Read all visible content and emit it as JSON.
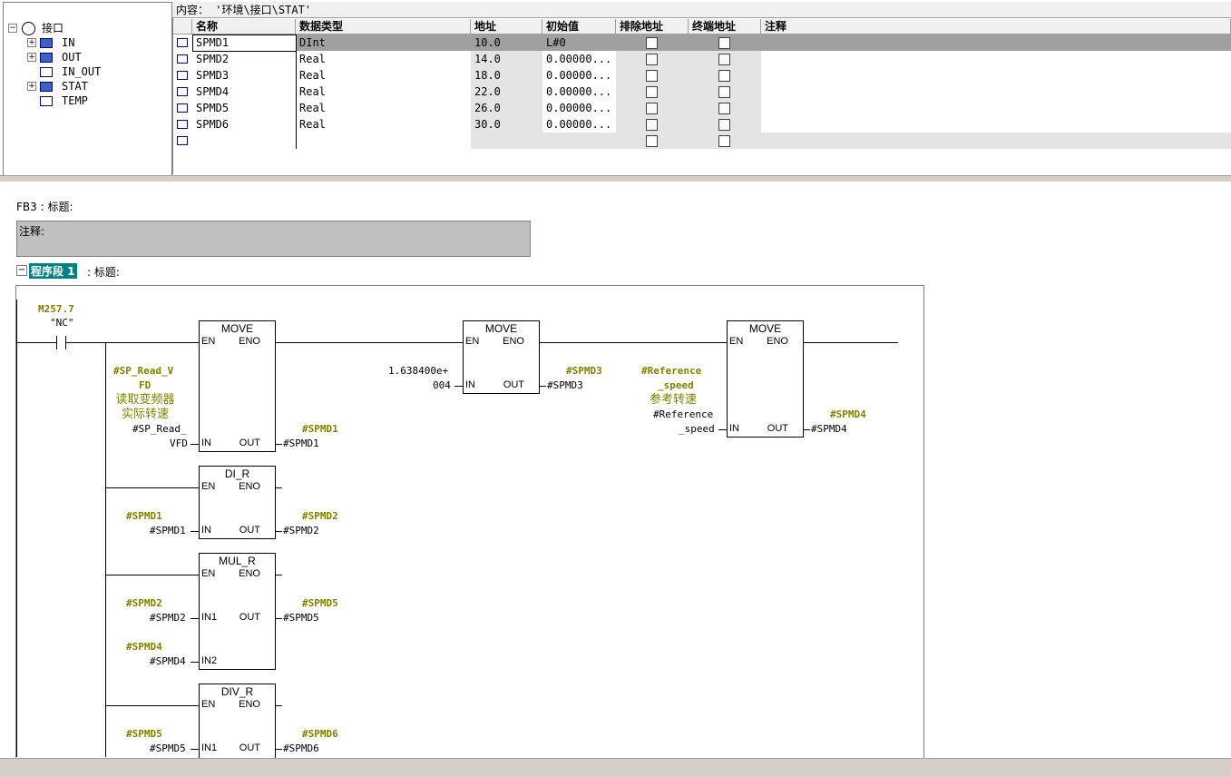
{
  "tree": {
    "root": "接口",
    "items": [
      {
        "label": "IN",
        "expand": "+"
      },
      {
        "label": "OUT",
        "expand": "+"
      },
      {
        "label": "IN_OUT",
        "expand": ""
      },
      {
        "label": "STAT",
        "expand": "+"
      },
      {
        "label": "TEMP",
        "expand": ""
      }
    ]
  },
  "content_path": "内容：  '环境\\接口\\STAT'",
  "table": {
    "headers": [
      "名称",
      "数据类型",
      "地址",
      "初始值",
      "排除地址",
      "终端地址",
      "注释"
    ],
    "rows": [
      {
        "name": "SPMD1",
        "type": "DInt",
        "address": "10.0",
        "init": "L#0"
      },
      {
        "name": "SPMD2",
        "type": "Real",
        "address": "14.0",
        "init": "0.00000..."
      },
      {
        "name": "SPMD3",
        "type": "Real",
        "address": "18.0",
        "init": "0.00000..."
      },
      {
        "name": "SPMD4",
        "type": "Real",
        "address": "22.0",
        "init": "0.00000..."
      },
      {
        "name": "SPMD5",
        "type": "Real",
        "address": "26.0",
        "init": "0.00000..."
      },
      {
        "name": "SPMD6",
        "type": "Real",
        "address": "30.0",
        "init": "0.00000..."
      }
    ]
  },
  "block": {
    "title": "FB3 : 标题:",
    "comment_label": "注释:",
    "network_label": "程序段 1",
    "network_title": ": 标题:"
  },
  "ladder": {
    "contact": {
      "address": "M257.7",
      "symbol": "\"NC\""
    },
    "move1": {
      "title": "MOVE",
      "en": "EN",
      "eno": "ENO",
      "in": "IN",
      "out": "OUT",
      "in_sym": "#SP_Read_V",
      "in_sym2": "FD",
      "in_cmt1": "读取变频器",
      "in_cmt2": "实际转速",
      "in_op1": "#SP_Read_",
      "in_op2": "VFD",
      "out_sym": "#SPMD1",
      "out_op": "#SPMD1"
    },
    "move2": {
      "title": "MOVE",
      "en": "EN",
      "eno": "ENO",
      "in": "IN",
      "out": "OUT",
      "in_op1": "1.638400e+",
      "in_op2": "004",
      "out_sym": "#SPMD3",
      "out_op": "#SPMD3"
    },
    "move3": {
      "title": "MOVE",
      "en": "EN",
      "eno": "ENO",
      "in": "IN",
      "out": "OUT",
      "in_sym1": "#Reference",
      "in_sym2": "_speed",
      "in_cmt": "参考转速",
      "in_op1": "#Reference",
      "in_op2": "_speed",
      "out_sym": "#SPMD4",
      "out_op": "#SPMD4"
    },
    "di_r": {
      "title": "DI_R",
      "en": "EN",
      "eno": "ENO",
      "in": "IN",
      "out": "OUT",
      "in_sym": "#SPMD1",
      "in_op": "#SPMD1",
      "out_sym": "#SPMD2",
      "out_op": "#SPMD2"
    },
    "mul_r": {
      "title": "MUL_R",
      "en": "EN",
      "eno": "ENO",
      "in1": "IN1",
      "in2": "IN2",
      "out": "OUT",
      "in1_sym": "#SPMD2",
      "in1_op": "#SPMD2",
      "in2_sym": "#SPMD4",
      "in2_op": "#SPMD4",
      "out_sym": "#SPMD5",
      "out_op": "#SPMD5"
    },
    "div_r": {
      "title": "DIV_R",
      "en": "EN",
      "eno": "ENO",
      "in1": "IN1",
      "out": "OUT",
      "in1_sym": "#SPMD5",
      "in1_op": "#SPMD5",
      "out_sym": "#SPMD6",
      "out_op": "#SPMD6"
    }
  },
  "colors": {
    "accent_network": "#008080",
    "symbol": "#808000",
    "selected_row": "#a0a0a0",
    "comment_box": "#c0c0c0"
  }
}
